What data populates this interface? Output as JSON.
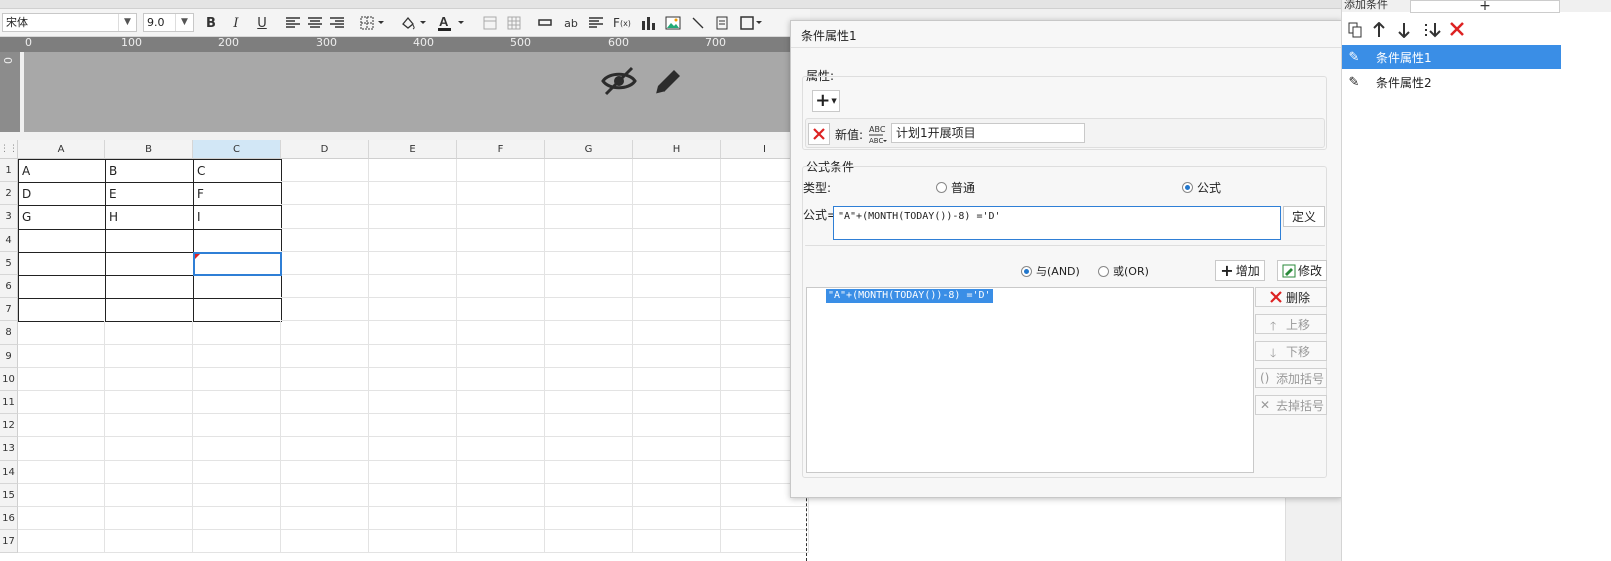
{
  "toolbar": {
    "font_name": "宋体",
    "font_size": "9.0"
  },
  "ruler": {
    "ticks": [
      "0",
      "100",
      "200",
      "300",
      "400",
      "500",
      "600",
      "700"
    ],
    "vertical_start": "0"
  },
  "grid": {
    "columns": [
      "A",
      "B",
      "C",
      "D",
      "E",
      "F",
      "G",
      "H",
      "I"
    ],
    "rows": [
      "1",
      "2",
      "3",
      "4",
      "5",
      "6",
      "7",
      "8",
      "9",
      "10",
      "11",
      "12",
      "13",
      "14",
      "15",
      "16",
      "17"
    ],
    "cells": {
      "A1": "A",
      "B1": "B",
      "C1": "C",
      "A2": "D",
      "B2": "E",
      "C2": "F",
      "A3": "G",
      "B3": "H",
      "C3": "I"
    },
    "selected_cell": "C5"
  },
  "dialog": {
    "title": "条件属性1",
    "attributes_label": "属性:",
    "add_icon": "plus-icon",
    "new_value_label": "新值:",
    "new_value": "计划1开展项目",
    "formula_section_label": "公式条件",
    "type_label": "类型:",
    "type_normal": "普通",
    "type_formula": "公式",
    "formula_label": "公式=",
    "formula_value": "\"A\"+(MONTH(TODAY())-8) ='D'",
    "define_button": "定义",
    "and_label": "与(AND)",
    "or_label": "或(OR)",
    "add_button": "增加",
    "modify_button": "修改",
    "condition_list": [
      "\"A\"+(MONTH(TODAY())-8) ='D'"
    ],
    "delete_button": "删除",
    "move_up_button": "上移",
    "move_down_button": "下移",
    "add_paren_button": "添加括号",
    "remove_paren_button": "去掉括号"
  },
  "right_panel": {
    "title": "添加条件",
    "add_symbol": "+",
    "items": [
      "条件属性1",
      "条件属性2"
    ],
    "selected_index": 0,
    "accent_color": "#3a8ee6"
  }
}
